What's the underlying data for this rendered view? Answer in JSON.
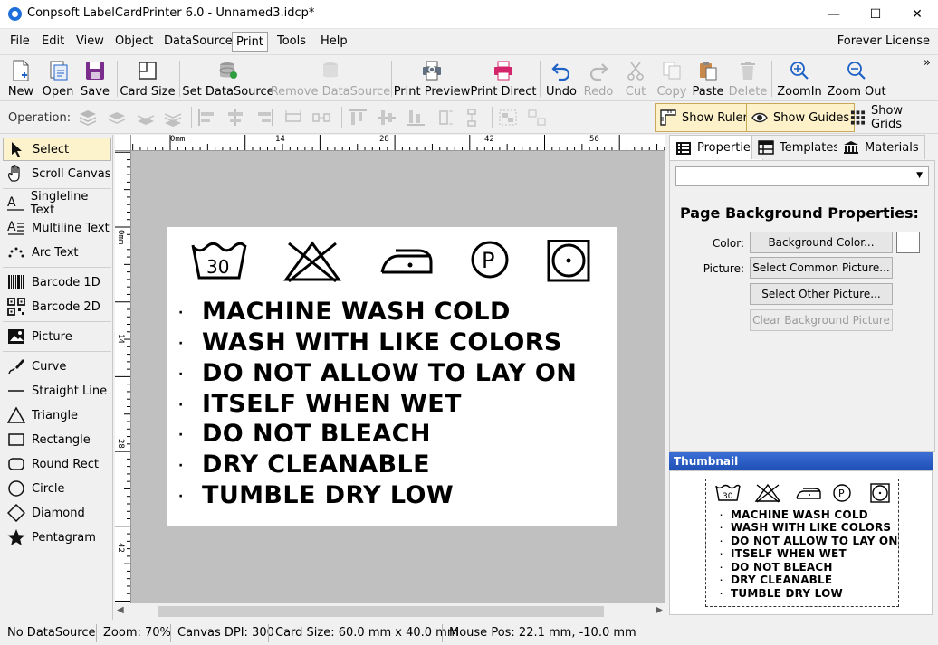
{
  "window": {
    "title": "Conpsoft LabelCardPrinter 6.0 - Unnamed3.idcp*",
    "controls": [
      "—",
      "☐",
      "✕"
    ]
  },
  "menu": {
    "items": [
      "File",
      "Edit",
      "View",
      "Object",
      "DataSource",
      "Print",
      "Tools",
      "Help"
    ],
    "license": "Forever License"
  },
  "toolbar": {
    "buttons": [
      {
        "label": "New",
        "icon": "new-file-icon",
        "enabled": true
      },
      {
        "label": "Open",
        "icon": "open-folder-icon",
        "enabled": true
      },
      {
        "label": "Save",
        "icon": "save-icon",
        "enabled": true
      },
      {
        "label": "Card Size",
        "icon": "card-size-icon",
        "enabled": true
      },
      {
        "label": "Set DataSource",
        "icon": "database-icon",
        "enabled": true
      },
      {
        "label": "Remove DataSource",
        "icon": "remove-database-icon",
        "enabled": false
      },
      {
        "label": "Print Preview",
        "icon": "print-preview-icon",
        "enabled": true
      },
      {
        "label": "Print Direct",
        "icon": "printer-icon",
        "enabled": true
      },
      {
        "label": "Undo",
        "icon": "undo-icon",
        "enabled": true
      },
      {
        "label": "Redo",
        "icon": "redo-icon",
        "enabled": false
      },
      {
        "label": "Cut",
        "icon": "cut-icon",
        "enabled": false
      },
      {
        "label": "Copy",
        "icon": "copy-icon",
        "enabled": false
      },
      {
        "label": "Paste",
        "icon": "paste-icon",
        "enabled": true
      },
      {
        "label": "Delete",
        "icon": "delete-icon",
        "enabled": false
      },
      {
        "label": "ZoomIn",
        "icon": "zoom-in-icon",
        "enabled": true
      },
      {
        "label": "Zoom Out",
        "icon": "zoom-out-icon",
        "enabled": true
      }
    ],
    "overflow": "»"
  },
  "operation": {
    "label": "Operation:",
    "toggles": {
      "show_ruler": "Show Ruler",
      "show_guides": "Show Guides",
      "show_grids": "Show Grids"
    }
  },
  "tools": [
    {
      "label": "Select",
      "icon": "pointer-icon",
      "selected": true
    },
    {
      "label": "Scroll Canvas",
      "icon": "hand-icon",
      "selected": false
    },
    {
      "label": "Singleline Text",
      "icon": "singleline-text-icon",
      "selected": false
    },
    {
      "label": "Multiline Text",
      "icon": "multiline-text-icon",
      "selected": false
    },
    {
      "label": "Arc Text",
      "icon": "arc-text-icon",
      "selected": false
    },
    {
      "label": "Barcode 1D",
      "icon": "barcode-icon",
      "selected": false
    },
    {
      "label": "Barcode 2D",
      "icon": "qr-code-icon",
      "selected": false
    },
    {
      "label": "Picture",
      "icon": "picture-icon",
      "selected": false
    },
    {
      "label": "Curve",
      "icon": "curve-icon",
      "selected": false
    },
    {
      "label": "Straight Line",
      "icon": "line-icon",
      "selected": false
    },
    {
      "label": "Triangle",
      "icon": "triangle-icon",
      "selected": false
    },
    {
      "label": "Rectangle",
      "icon": "rectangle-icon",
      "selected": false
    },
    {
      "label": "Round Rect",
      "icon": "round-rect-icon",
      "selected": false
    },
    {
      "label": "Circle",
      "icon": "circle-icon",
      "selected": false
    },
    {
      "label": "Diamond",
      "icon": "diamond-icon",
      "selected": false
    },
    {
      "label": "Pentagram",
      "icon": "star-icon",
      "selected": false
    }
  ],
  "ruler": {
    "h_labels": [
      "0mm",
      "14",
      "28",
      "42",
      "56"
    ],
    "v_labels": [
      "0mm",
      "14",
      "28",
      "42"
    ]
  },
  "card": {
    "care_symbols": [
      "wash-30-icon",
      "do-not-bleach-icon",
      "iron-icon",
      "dry-clean-p-icon",
      "tumble-dry-icon"
    ],
    "wash_temperature": "30",
    "dry_clean_letter": "P",
    "lines": [
      "MACHINE WASH COLD",
      "WASH WITH LIKE COLORS",
      "DO NOT ALLOW TO LAY ON",
      "ITSELF WHEN WET",
      "DO NOT BLEACH",
      "DRY CLEANABLE",
      "TUMBLE DRY LOW"
    ],
    "bullet": "·"
  },
  "right_panel": {
    "tabs": [
      "Properties",
      "Templates",
      "Materials"
    ],
    "active_tab": "Properties",
    "section_title": "Page Background Properties:",
    "color_label": "Color:",
    "picture_label": "Picture:",
    "buttons": {
      "background_color": "Background Color...",
      "select_common_picture": "Select Common Picture...",
      "select_other_picture": "Select Other Picture...",
      "clear_background_picture": "Clear Background Picture"
    },
    "color_value": "#ffffff",
    "thumbnail_title": "Thumbnail"
  },
  "status": {
    "datasource": "No DataSource",
    "zoom": "Zoom: 70%",
    "dpi": "Canvas DPI: 300",
    "card_size": "Card Size: 60.0 mm x 40.0 mm",
    "mouse_pos": "Mouse Pos: 22.1 mm, -10.0 mm"
  },
  "colors": {
    "accent_blue": "#1e6fd9",
    "selected_tool_bg": "#fcf3cc",
    "canvas_bg": "#c0c0c0",
    "print_pink": "#d4246a",
    "save_purple": "#7b2d8e",
    "undo_blue": "#1f62c6"
  }
}
